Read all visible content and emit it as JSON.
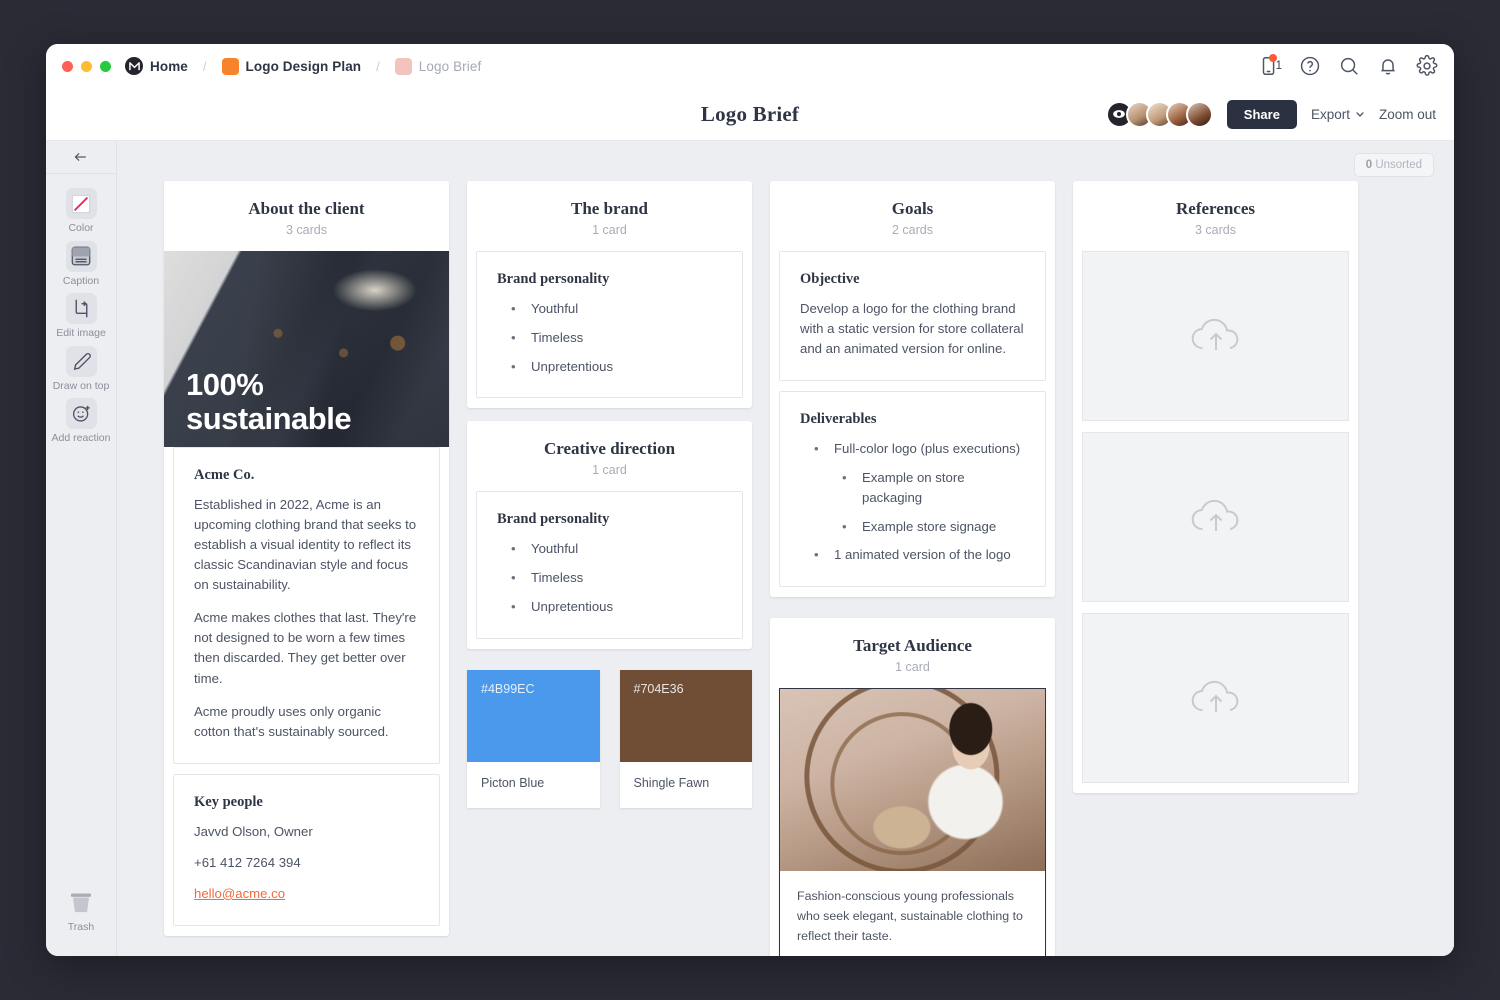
{
  "window": {
    "breadcrumb": [
      {
        "label": "Home",
        "type": "home",
        "color": "#23242c"
      },
      {
        "label": "Logo Design Plan",
        "type": "board",
        "color": "#f7842a"
      },
      {
        "label": "Logo Brief",
        "type": "board",
        "color": "#f3c3bd"
      }
    ],
    "topbar_icons": [
      {
        "name": "mobile-icon",
        "badge": "1"
      },
      {
        "name": "help-icon"
      },
      {
        "name": "search-icon"
      },
      {
        "name": "notifications-icon"
      },
      {
        "name": "settings-icon"
      }
    ]
  },
  "header": {
    "title": "Logo Brief",
    "share_label": "Share",
    "export_label": "Export",
    "zoom_label": "Zoom out",
    "presence_count": 4
  },
  "sidebar": {
    "back_label": "Back",
    "tools": [
      {
        "label": "Color",
        "icon": "color-icon"
      },
      {
        "label": "Caption",
        "icon": "caption-icon"
      },
      {
        "label": "Edit image",
        "icon": "crop-icon"
      },
      {
        "label": "Draw on top",
        "icon": "pen-icon"
      },
      {
        "label": "Add reaction",
        "icon": "emoji-icon"
      }
    ],
    "trash_label": "Trash"
  },
  "canvas": {
    "unsorted_count": "0",
    "unsorted_label": "Unsorted"
  },
  "columns": [
    {
      "title": "About the client",
      "count": "3 cards",
      "image_overlay_line1": "100%",
      "image_overlay_line2": "sustainable",
      "cards": [
        {
          "heading": "Acme Co.",
          "paragraphs": [
            "Established in 2022, Acme is an upcoming clothing brand that seeks to establish a visual identity to reflect its classic Scandinavian style and focus on sustainability.",
            "Acme makes clothes that last. They're not designed to be worn a few times then discarded. They get better over time.",
            "Acme proudly uses only organic cotton that's sustainably sourced."
          ]
        },
        {
          "heading": "Key people",
          "lines": [
            "Javvd Olson, Owner",
            "+61 412 7264 394"
          ],
          "email": "hello@acme.co"
        }
      ]
    },
    {
      "title": "The brand",
      "count": "1 card",
      "card": {
        "heading": "Brand personality",
        "bullets": [
          "Youthful",
          "Timeless",
          "Unpretentious"
        ]
      }
    },
    {
      "title": "Creative direction",
      "count": "1 card",
      "card": {
        "heading": "Brand personality",
        "bullets": [
          "Youthful",
          "Timeless",
          "Unpretentious"
        ]
      },
      "swatches": [
        {
          "hex": "#4B99EC",
          "name": "Picton Blue"
        },
        {
          "hex": "#704E36",
          "name": "Shingle Fawn"
        }
      ]
    },
    {
      "title": "Goals",
      "count": "2 cards",
      "objective": {
        "heading": "Objective",
        "text": "Develop a logo for the clothing brand with a static version for store collateral and an animated version for online."
      },
      "deliverables": {
        "heading": "Deliverables",
        "bullets": [
          {
            "text": "Full-color logo (plus executions)",
            "level": 1
          },
          {
            "text": "Example on store packaging",
            "level": 2
          },
          {
            "text": "Example store signage",
            "level": 2
          },
          {
            "text": "1 animated version of the logo",
            "level": 1
          }
        ]
      }
    },
    {
      "title": "Target Audience",
      "count": "1 card",
      "caption": "Fashion-conscious young professionals who seek elegant, sustainable clothing to reflect their taste."
    },
    {
      "title": "References",
      "count": "3 cards",
      "placeholders": 3,
      "placeholder_icon": "cloud-upload-icon"
    }
  ]
}
